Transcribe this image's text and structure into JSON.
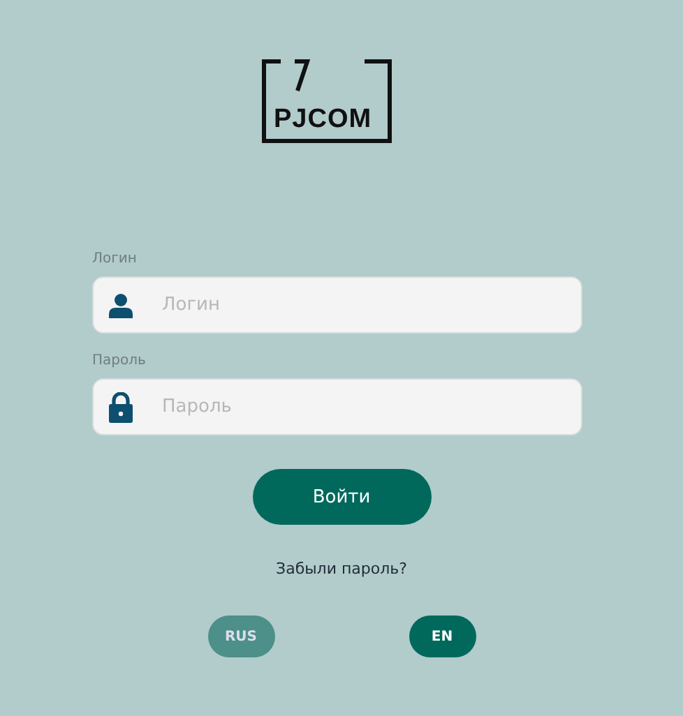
{
  "logo": {
    "text": "PJCOM"
  },
  "fields": [
    {
      "label": "Логин",
      "placeholder": "Логин",
      "kind": "user"
    },
    {
      "label": "Пароль",
      "placeholder": "Пароль",
      "kind": "lock"
    }
  ],
  "submit": "Войти",
  "forgot": "Забыли пароль?",
  "languages": [
    {
      "label": "RUS",
      "selected": false
    },
    {
      "label": "EN",
      "selected": true
    }
  ]
}
